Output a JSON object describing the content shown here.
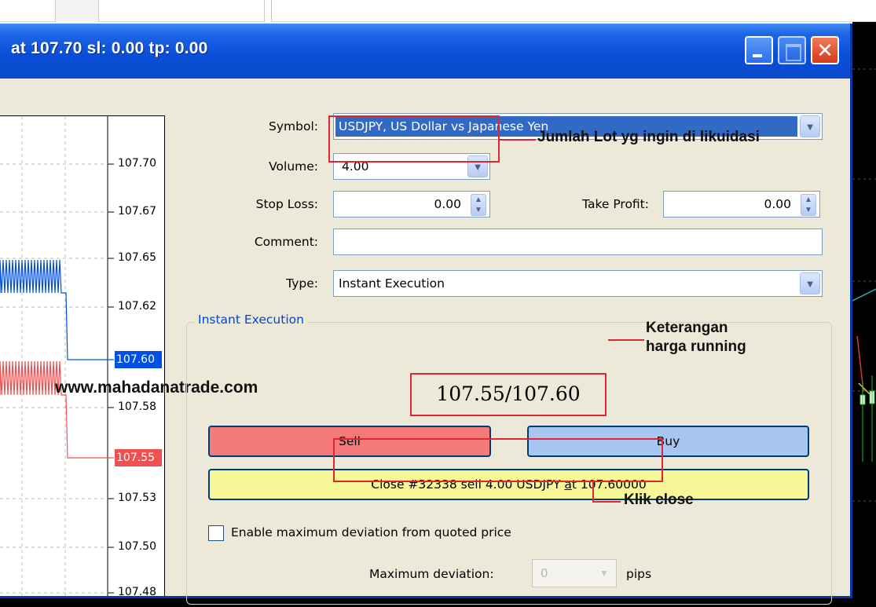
{
  "window": {
    "title": "at 107.70 sl: 0.00 tp: 0.00",
    "close_glyph": "✕"
  },
  "chart": {
    "price_ticks": [
      "107.70",
      "107.67",
      "107.65",
      "107.62",
      "107.58",
      "107.53",
      "107.50",
      "107.48"
    ],
    "ask_tag": "107.60",
    "bid_tag": "107.55",
    "ask_color": "#0050e6",
    "bid_color": "#f05050",
    "watermark": "www.mahadanatrade.com"
  },
  "form": {
    "symbol_label": "Symbol:",
    "symbol_value": "USDJPY, US Dollar vs Japanese Yen",
    "volume_label": "Volume:",
    "volume_value": "4.00",
    "stoploss_label": "Stop Loss:",
    "stoploss_value": "0.00",
    "takeprofit_label": "Take Profit:",
    "takeprofit_value": "0.00",
    "comment_label": "Comment:",
    "comment_value": "",
    "type_label": "Type:",
    "type_value": "Instant Execution"
  },
  "execution": {
    "group_title": "Instant Execution",
    "price_display": "107.55/107.60",
    "sell_label": "Sell",
    "buy_label": "Buy",
    "close_label_prefix": "Close #32338 sell 4.00 USDJPY ",
    "close_label_underlined": "a",
    "close_label_suffix": "t 107.60000",
    "deviation_checkbox_label": "Enable maximum deviation from quoted price",
    "deviation_checked": false,
    "max_deviation_label": "Maximum deviation:",
    "max_deviation_value": "0",
    "pips_label": "pips"
  },
  "annotations": {
    "volume_note": "Jumlah Lot yg ingin di likuidasi",
    "price_note_line1": "Keterangan",
    "price_note_line2": "harga running",
    "close_note": "Klik close",
    "color": "#e0262f"
  },
  "colors": {
    "titlebar": "#0a4fd8",
    "dialog_bg": "#ece9d8",
    "sell_button": "#f47a7a",
    "buy_button": "#a9c5f2",
    "close_button": "#f8f797",
    "symbol_highlight": "#316ac5"
  }
}
